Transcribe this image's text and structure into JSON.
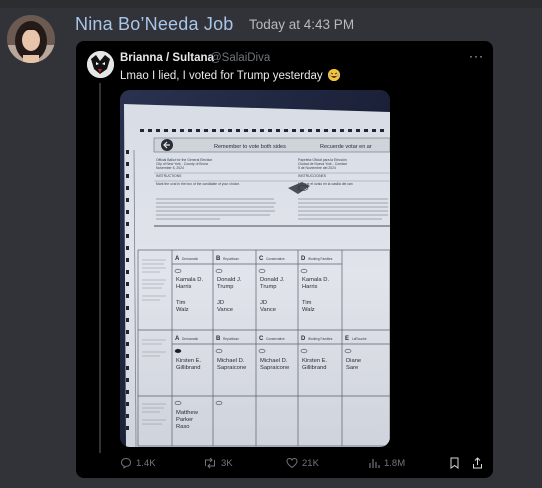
{
  "message": {
    "author": "Nina Bo’Needa Job",
    "timestamp": "Today at 4:43 PM"
  },
  "embed": {
    "display_name": "Brianna / Sultana",
    "handle": "@SalaiDiva",
    "text": "Lmao I lied, I voted for Trump yesterday",
    "emoji": "rolling-on-floor-laughing-emoji",
    "more_label": "···"
  },
  "ballot": {
    "header": "Remember to vote both sides",
    "header_es": "Recuerde votar en ar",
    "official_line1": "Official Ballot for the General Election",
    "official_line2": "City of New York - County of Bronx",
    "official_line3": "November 5, 2024",
    "official_es1": "Papeleta Oficial para la Elección",
    "official_es2": "Ciudad de Nueva York - Condad",
    "official_es3": "5 de Noviembre del 2024",
    "instructions": "INSTRUCTIONS",
    "instructions_es": "INSTRUCCIONES",
    "instr_line": "Mark the oval in the box of the candidate of your choice.",
    "instr_line_es": "Marque el óvalo en la casilla del can",
    "columns": [
      {
        "letter": "A",
        "party": "Democratic"
      },
      {
        "letter": "B",
        "party": "Republican"
      },
      {
        "letter": "C",
        "party": "Conservative"
      },
      {
        "letter": "D",
        "party": "Working Families"
      }
    ],
    "row1_candidates": [
      {
        "p": "Kamala D.",
        "p2": "Harris",
        "v": "Tim",
        "v2": "Walz"
      },
      {
        "p": "Donald J.",
        "p2": "Trump",
        "v": "JD",
        "v2": "Vance"
      },
      {
        "p": "Donald J.",
        "p2": "Trump",
        "v": "JD",
        "v2": "Vance"
      },
      {
        "p": "Kamala D.",
        "p2": "Harris",
        "v": "Tim",
        "v2": "Walz"
      }
    ],
    "row2_parties": [
      "Democratic",
      "Republican",
      "Conservative",
      "Working Families",
      "LaRouche"
    ],
    "row2_candidates": [
      "Kirsten E.\nGillibrand",
      "Michael D.\nSapraicone",
      "Michael D.\nSapraicone",
      "Kirsten E.\nGillibrand",
      "Diane\nSare"
    ],
    "row3_candidate": "Matthew\nParker\nRaso"
  },
  "actions": {
    "replies": "1.4K",
    "reposts": "3K",
    "likes": "21K",
    "views": "1.8M"
  },
  "colors": {
    "background": "#313338",
    "author": "#a9c6e8",
    "embed_bg": "#000000",
    "muted": "#71767b"
  }
}
